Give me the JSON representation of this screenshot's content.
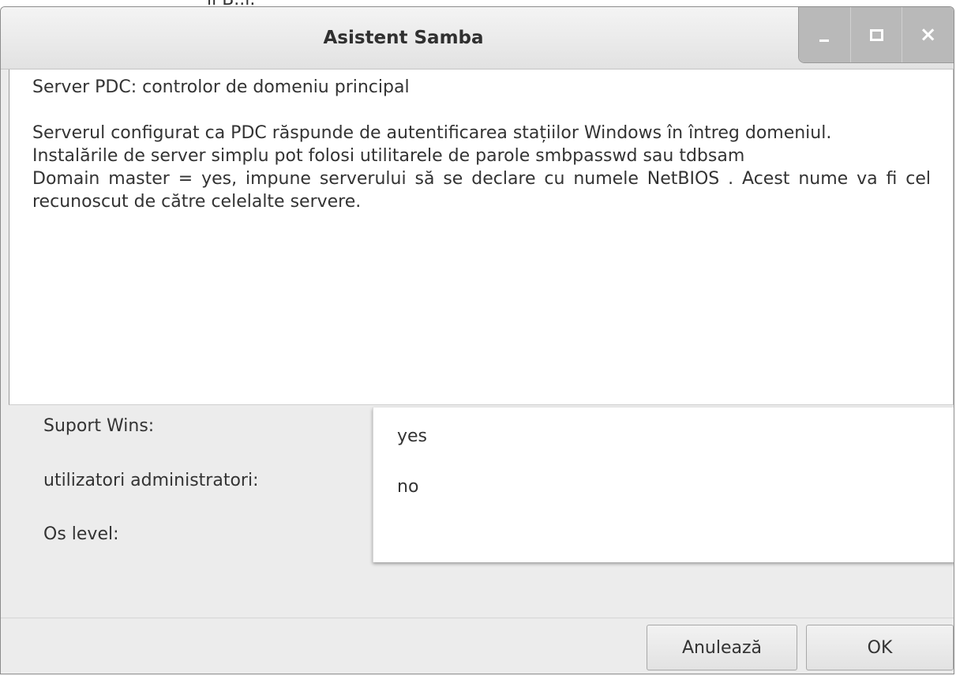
{
  "background": {
    "partial_text": "ll   B..l."
  },
  "window": {
    "title": "Asistent Samba",
    "controls": {
      "minimize": "_",
      "maximize": "□",
      "close": "×"
    }
  },
  "description": {
    "heading": "Server PDC: controlor de domeniu principal",
    "line1": "Serverul configurat ca PDC răspunde de autentificarea stațiilor Windows în întreg domeniul.",
    "line2": "Instalările de server simplu pot folosi utilitarele de parole smbpasswd sau tdbsam",
    "line3": "Domain master = yes, impune serverului să se declare cu numele NetBIOS . Acest nume va fi cel recunoscut de către celelalte servere."
  },
  "fields": {
    "labels": [
      "Suport Wins:",
      "utilizatori administratori:",
      "Os level:"
    ],
    "values": [
      "yes",
      "no",
      ""
    ]
  },
  "buttons": {
    "cancel": "Anulează",
    "ok": "OK"
  }
}
